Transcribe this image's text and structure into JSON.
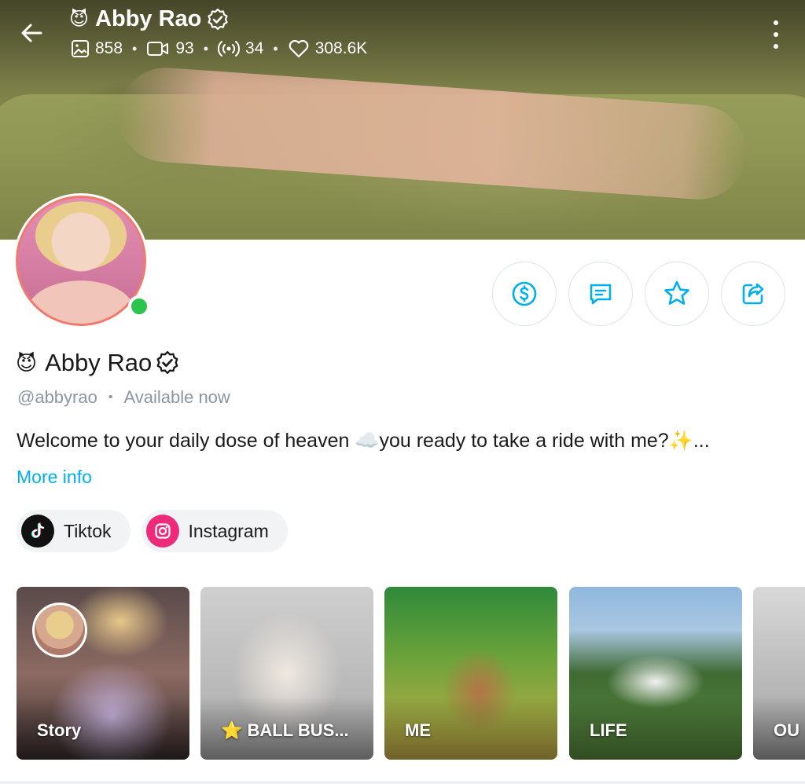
{
  "header": {
    "emoji": "😈",
    "name": "Abby Rao",
    "stats": {
      "photos": "858",
      "videos": "93",
      "streams": "34",
      "likes": "308.6K"
    }
  },
  "profile": {
    "emoji": "😈",
    "name": "Abby Rao",
    "handle": "@abbyrao",
    "separator": "•",
    "status": "Available now",
    "bio": "Welcome to your daily dose of heaven ☁️you ready to take a ride with me?✨...",
    "more_info": "More info"
  },
  "socials": [
    {
      "label": "Tiktok",
      "icon": "tiktok-icon"
    },
    {
      "label": "Instagram",
      "icon": "instagram-icon"
    }
  ],
  "highlights": [
    {
      "label": "Story"
    },
    {
      "label": "⭐ BALL BUS..."
    },
    {
      "label": "ME"
    },
    {
      "label": "LIFE"
    },
    {
      "label": "OU"
    }
  ],
  "colors": {
    "accent": "#00aff0",
    "online": "#2bc44f",
    "avatar_ring": "#f07a6e",
    "instagram": "#ee2a7b"
  }
}
